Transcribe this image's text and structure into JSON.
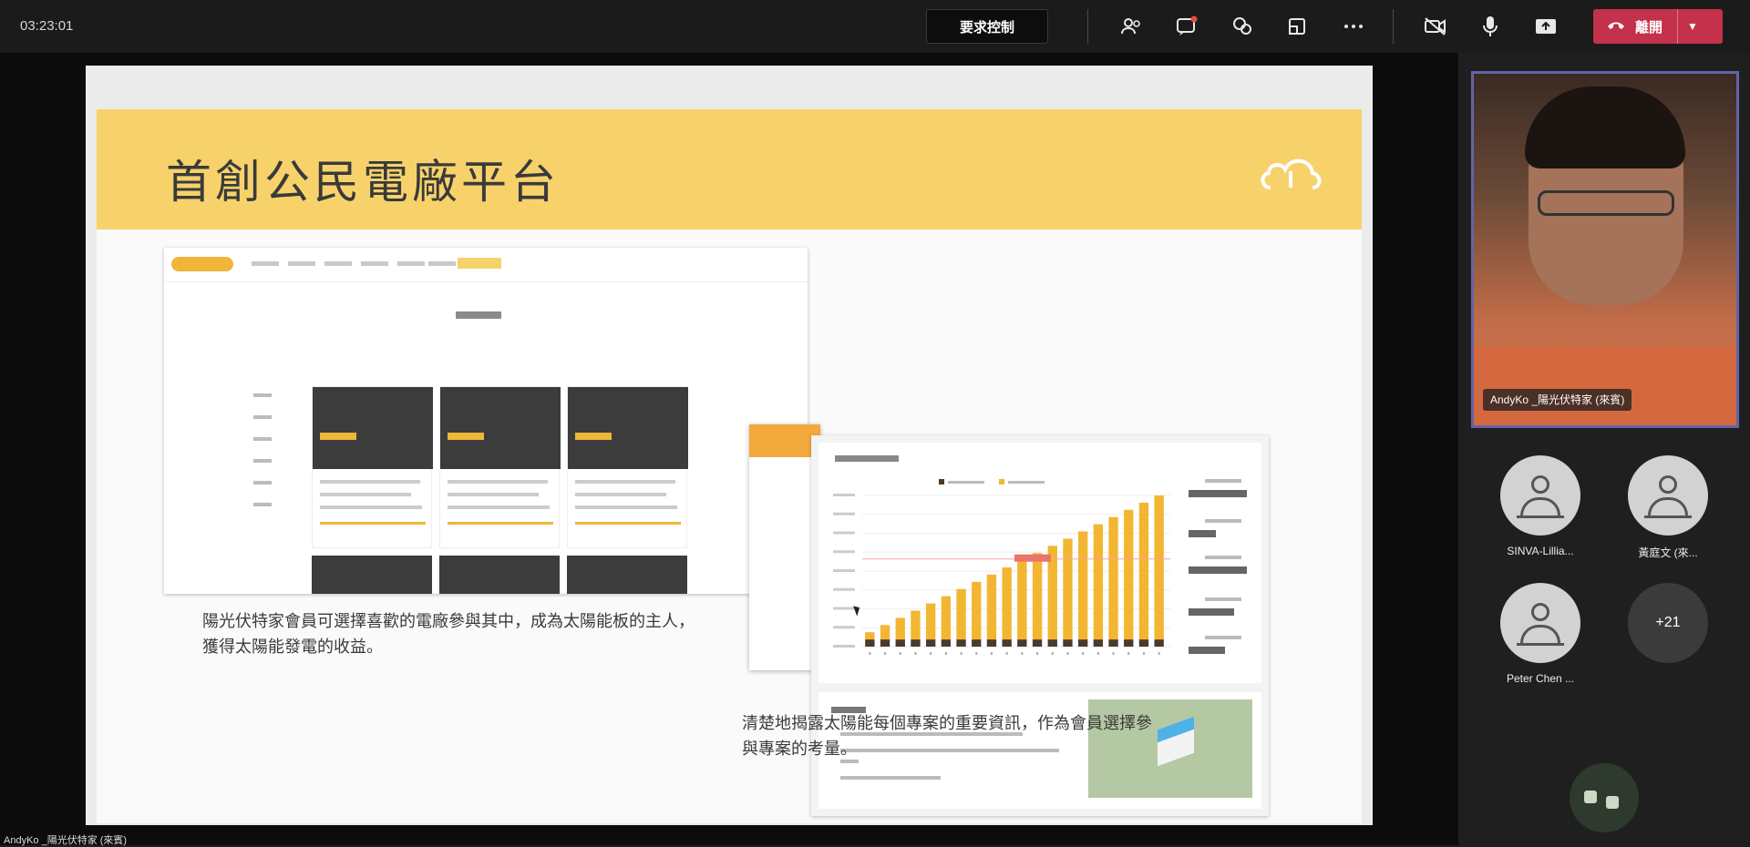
{
  "toolbar": {
    "timer": "03:23:01",
    "request_control_label": "要求控制",
    "hangup_label": "離開",
    "icons": [
      "people-icon",
      "chat-icon",
      "reactions-icon",
      "rooms-icon",
      "more-icon",
      "camera-off-icon",
      "mic-icon",
      "share-icon"
    ]
  },
  "slide": {
    "title": "首創公民電廠平台",
    "caption_left": "陽光伏特家會員可選擇喜歡的電廠參與其中，成為太陽能板的主人，獲得太陽能發電的收益。",
    "caption_right": "清楚地揭露太陽能每個專案的重要資訊，作為會員選擇參與專案的考量。",
    "accent_color": "#f7d26b"
  },
  "chart_data": {
    "type": "bar",
    "categories": [
      "1",
      "2",
      "3",
      "4",
      "5",
      "6",
      "7",
      "8",
      "9",
      "10",
      "11",
      "12",
      "13",
      "14",
      "15",
      "16",
      "17",
      "18",
      "19",
      "20"
    ],
    "series": [
      {
        "values": [
          1,
          2,
          3,
          4,
          5,
          6,
          7,
          8,
          9,
          10,
          11,
          12,
          13,
          14,
          15,
          16,
          17,
          18,
          19,
          20
        ]
      },
      {
        "values": [
          1,
          1,
          1,
          1,
          1,
          1,
          1,
          1,
          1,
          1,
          1,
          1,
          1,
          1,
          1,
          1,
          1,
          1,
          1,
          1
        ]
      }
    ],
    "colors": [
      "#f3b632",
      "#4a3a2a"
    ]
  },
  "side_panel": {
    "presenter_label": "AndyKo _陽光伏特家 (來賓)",
    "participants": [
      {
        "name": "SINVA-Lillia..."
      },
      {
        "name": "黃庭文 (來..."
      },
      {
        "name": "Peter Chen ..."
      }
    ],
    "more_count": "+21"
  },
  "bottom_label": "AndyKo _陽光伏特家 (來賓)"
}
